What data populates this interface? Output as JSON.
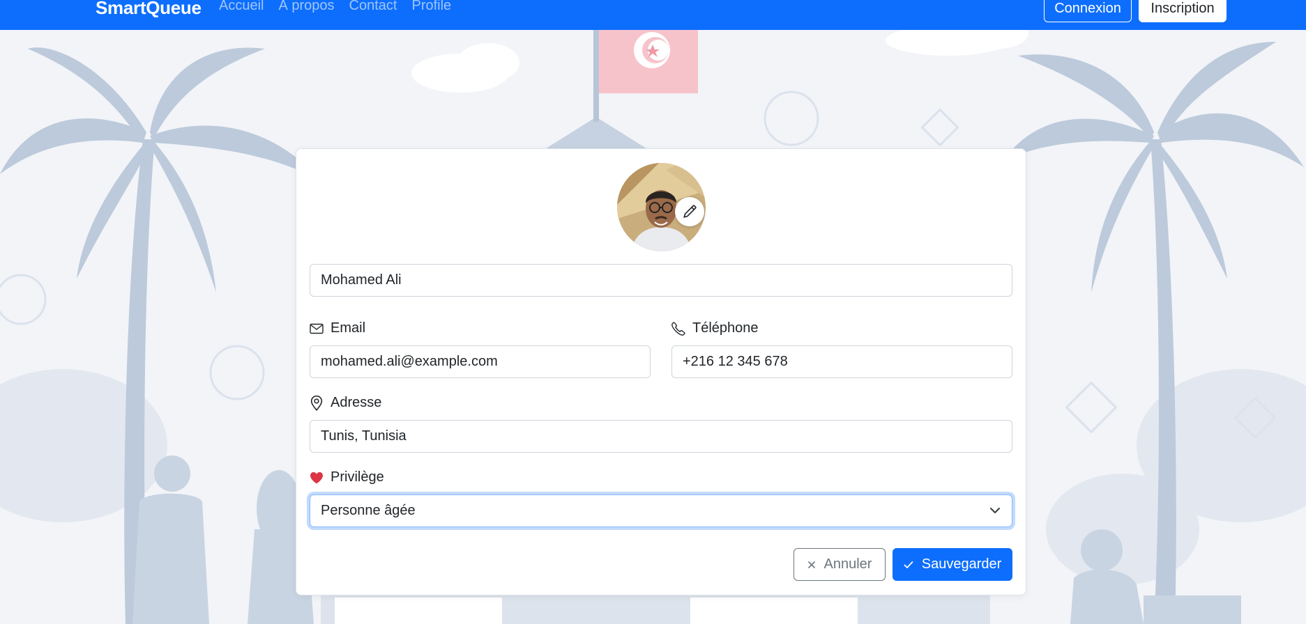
{
  "colors": {
    "primary": "#0d6efd",
    "danger_heart": "#dc3545",
    "secondary": "#6c757d"
  },
  "navbar": {
    "brand": "SmartQueue",
    "links": [
      "Accueil",
      "À propos",
      "Contact",
      "Profile"
    ],
    "login_label": "Connexion",
    "register_label": "Inscription"
  },
  "profile": {
    "name_value": "Mohamed Ali",
    "email_label": "Email",
    "email_value": "mohamed.ali@example.com",
    "phone_label": "Téléphone",
    "phone_value": "+216 12 345 678",
    "address_label": "Adresse",
    "address_value": "Tunis, Tunisia",
    "privilege_label": "Privilège",
    "privilege_value": "Personne âgée"
  },
  "actions": {
    "cancel_label": "Annuler",
    "save_label": "Sauvegarder"
  },
  "icons": [
    "envelope-icon",
    "telephone-icon",
    "geo-pin-icon",
    "heart-icon",
    "pencil-icon",
    "x-icon",
    "check-icon",
    "chevron-down-icon"
  ]
}
